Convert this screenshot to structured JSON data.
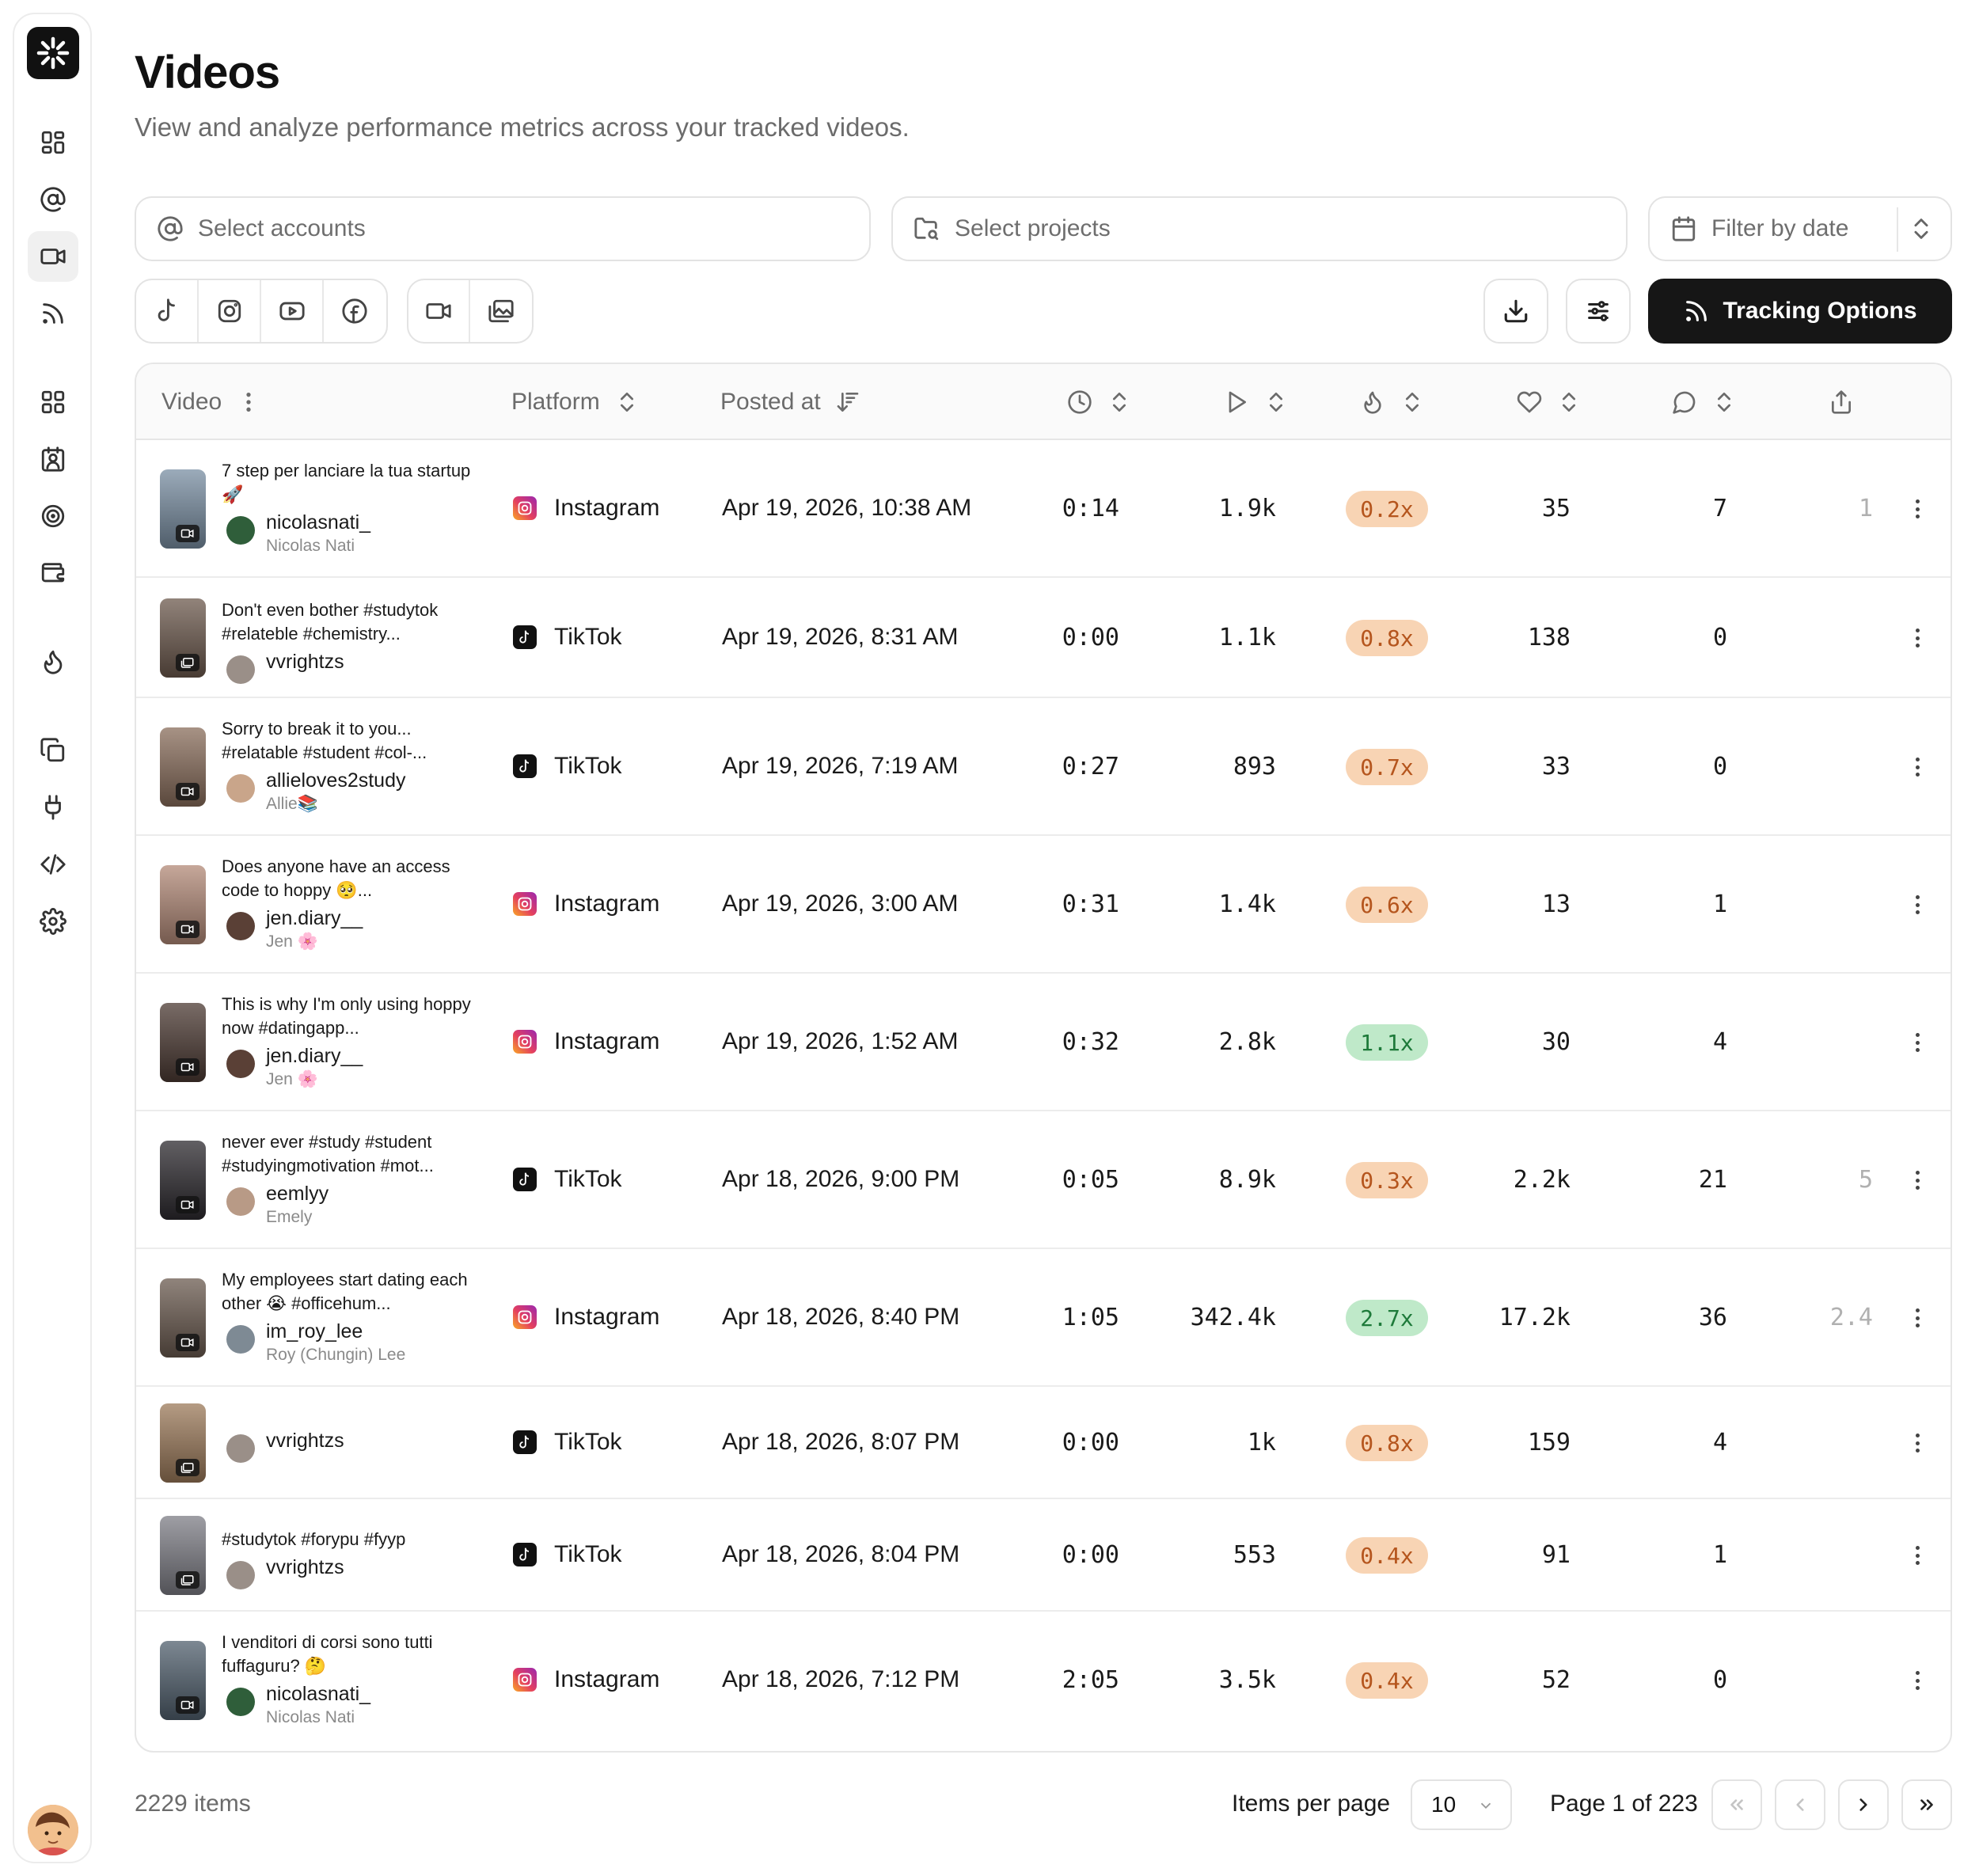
{
  "sidebar": {
    "logo_icon": "asterisk-logo-icon",
    "items": [
      {
        "icon": "dashboard-icon",
        "active": false
      },
      {
        "icon": "at-sign-icon",
        "active": false
      },
      {
        "icon": "video-icon",
        "active": true
      },
      {
        "icon": "rss-icon",
        "active": false
      },
      {
        "icon": "grid-icon",
        "active": false
      },
      {
        "icon": "contact-icon",
        "active": false
      },
      {
        "icon": "target-icon",
        "active": false
      },
      {
        "icon": "wallet-icon",
        "active": false
      },
      {
        "icon": "flame-icon",
        "active": false
      },
      {
        "icon": "copy-icon",
        "active": false
      },
      {
        "icon": "plug-icon",
        "active": false
      },
      {
        "icon": "code-icon",
        "active": false
      },
      {
        "icon": "settings-icon",
        "active": false
      }
    ]
  },
  "header": {
    "title": "Videos",
    "subtitle": "View and analyze performance metrics across your tracked videos."
  },
  "filters": {
    "accounts_placeholder": "Select accounts",
    "projects_placeholder": "Select projects",
    "date_placeholder": "Filter by date"
  },
  "toolbar": {
    "platform_filters": [
      "tiktok-icon",
      "instagram-icon",
      "youtube-icon",
      "facebook-icon"
    ],
    "type_filters": [
      "video-icon",
      "images-icon"
    ],
    "tracking_label": "Tracking Options"
  },
  "table": {
    "columns": {
      "video": "Video",
      "platform": "Platform",
      "posted": "Posted at"
    },
    "rows": [
      {
        "title": "7 step per lanciare la tua startup 🚀",
        "username": "nicolasnati_",
        "realname": "Nicolas Nati",
        "platform": "Instagram",
        "posted": "Apr 19, 2026, 10:38 AM",
        "duration": "0:14",
        "views": "1.9k",
        "ratio": "0.2x",
        "ratio_level": "low",
        "likes": "35",
        "comments": "7",
        "shares": "1",
        "media": "video",
        "thumb": "#7a8fa3",
        "avatar": "#2f5e3a"
      },
      {
        "title": "Don't even bother #studytok #relateble #chemistry...",
        "username": "vvrightzs",
        "realname": "",
        "platform": "TikTok",
        "posted": "Apr 19, 2026, 8:31 AM",
        "duration": "0:00",
        "views": "1.1k",
        "ratio": "0.8x",
        "ratio_level": "low",
        "likes": "138",
        "comments": "0",
        "shares": "",
        "media": "images",
        "thumb": "#6d5a4e",
        "avatar": "#9a8f88"
      },
      {
        "title": "Sorry to break it to you... #relatable #student #col-...",
        "username": "allieloves2study",
        "realname": "Allie📚",
        "platform": "TikTok",
        "posted": "Apr 19, 2026, 7:19 AM",
        "duration": "0:27",
        "views": "893",
        "ratio": "0.7x",
        "ratio_level": "low",
        "likes": "33",
        "comments": "0",
        "shares": "",
        "media": "video",
        "thumb": "#8a6e5c",
        "avatar": "#c9a58a"
      },
      {
        "title": "Does anyone have an access code to hoppy 🥺...",
        "username": "jen.diary__",
        "realname": "Jen 🌸",
        "platform": "Instagram",
        "posted": "Apr 19, 2026, 3:00 AM",
        "duration": "0:31",
        "views": "1.4k",
        "ratio": "0.6x",
        "ratio_level": "low",
        "likes": "13",
        "comments": "1",
        "shares": "",
        "media": "video",
        "thumb": "#b38a78",
        "avatar": "#5a4036"
      },
      {
        "title": "This is why I'm only using hoppy now #datingapp...",
        "username": "jen.diary__",
        "realname": "Jen 🌸",
        "platform": "Instagram",
        "posted": "Apr 19, 2026, 1:52 AM",
        "duration": "0:32",
        "views": "2.8k",
        "ratio": "1.1x",
        "ratio_level": "high",
        "likes": "30",
        "comments": "4",
        "shares": "",
        "media": "video",
        "thumb": "#4c3a33",
        "avatar": "#5a4036"
      },
      {
        "title": "never ever #study #student #studyingmotivation #mot...",
        "username": "eemlyy",
        "realname": "Emely",
        "platform": "TikTok",
        "posted": "Apr 18, 2026, 9:00 PM",
        "duration": "0:05",
        "views": "8.9k",
        "ratio": "0.3x",
        "ratio_level": "low",
        "likes": "2.2k",
        "comments": "21",
        "shares": "5",
        "media": "video",
        "thumb": "#2d2a2f",
        "avatar": "#b89a86"
      },
      {
        "title": "My employees start dating each other 😭 #officehum...",
        "username": "im_roy_lee",
        "realname": "Roy (Chungin) Lee",
        "platform": "Instagram",
        "posted": "Apr 18, 2026, 8:40 PM",
        "duration": "1:05",
        "views": "342.4k",
        "ratio": "2.7x",
        "ratio_level": "high",
        "likes": "17.2k",
        "comments": "36",
        "shares": "2.4",
        "media": "video",
        "thumb": "#6b5b50",
        "avatar": "#7e8a94"
      },
      {
        "title": "",
        "username": "vvrightzs",
        "realname": "",
        "platform": "TikTok",
        "posted": "Apr 18, 2026, 8:07 PM",
        "duration": "0:00",
        "views": "1k",
        "ratio": "0.8x",
        "ratio_level": "low",
        "likes": "159",
        "comments": "4",
        "shares": "",
        "media": "images",
        "thumb": "#9c7a5a",
        "avatar": "#9a8f88"
      },
      {
        "title": "#studytok #forypu #fyyp",
        "username": "vvrightzs",
        "realname": "",
        "platform": "TikTok",
        "posted": "Apr 18, 2026, 8:04 PM",
        "duration": "0:00",
        "views": "553",
        "ratio": "0.4x",
        "ratio_level": "low",
        "likes": "91",
        "comments": "1",
        "shares": "",
        "media": "images",
        "thumb": "#7e7e86",
        "avatar": "#9a8f88"
      },
      {
        "title": "I venditori di corsi sono tutti fuffaguru? 🤔",
        "username": "nicolasnati_",
        "realname": "Nicolas Nati",
        "platform": "Instagram",
        "posted": "Apr 18, 2026, 7:12 PM",
        "duration": "2:05",
        "views": "3.5k",
        "ratio": "0.4x",
        "ratio_level": "low",
        "likes": "52",
        "comments": "0",
        "shares": "",
        "media": "video",
        "thumb": "#51606e",
        "avatar": "#2f5e3a"
      }
    ]
  },
  "footer": {
    "items_count": "2229 items",
    "items_per_page_label": "Items per page",
    "items_per_page": "10",
    "page_info": "Page 1 of 223"
  }
}
